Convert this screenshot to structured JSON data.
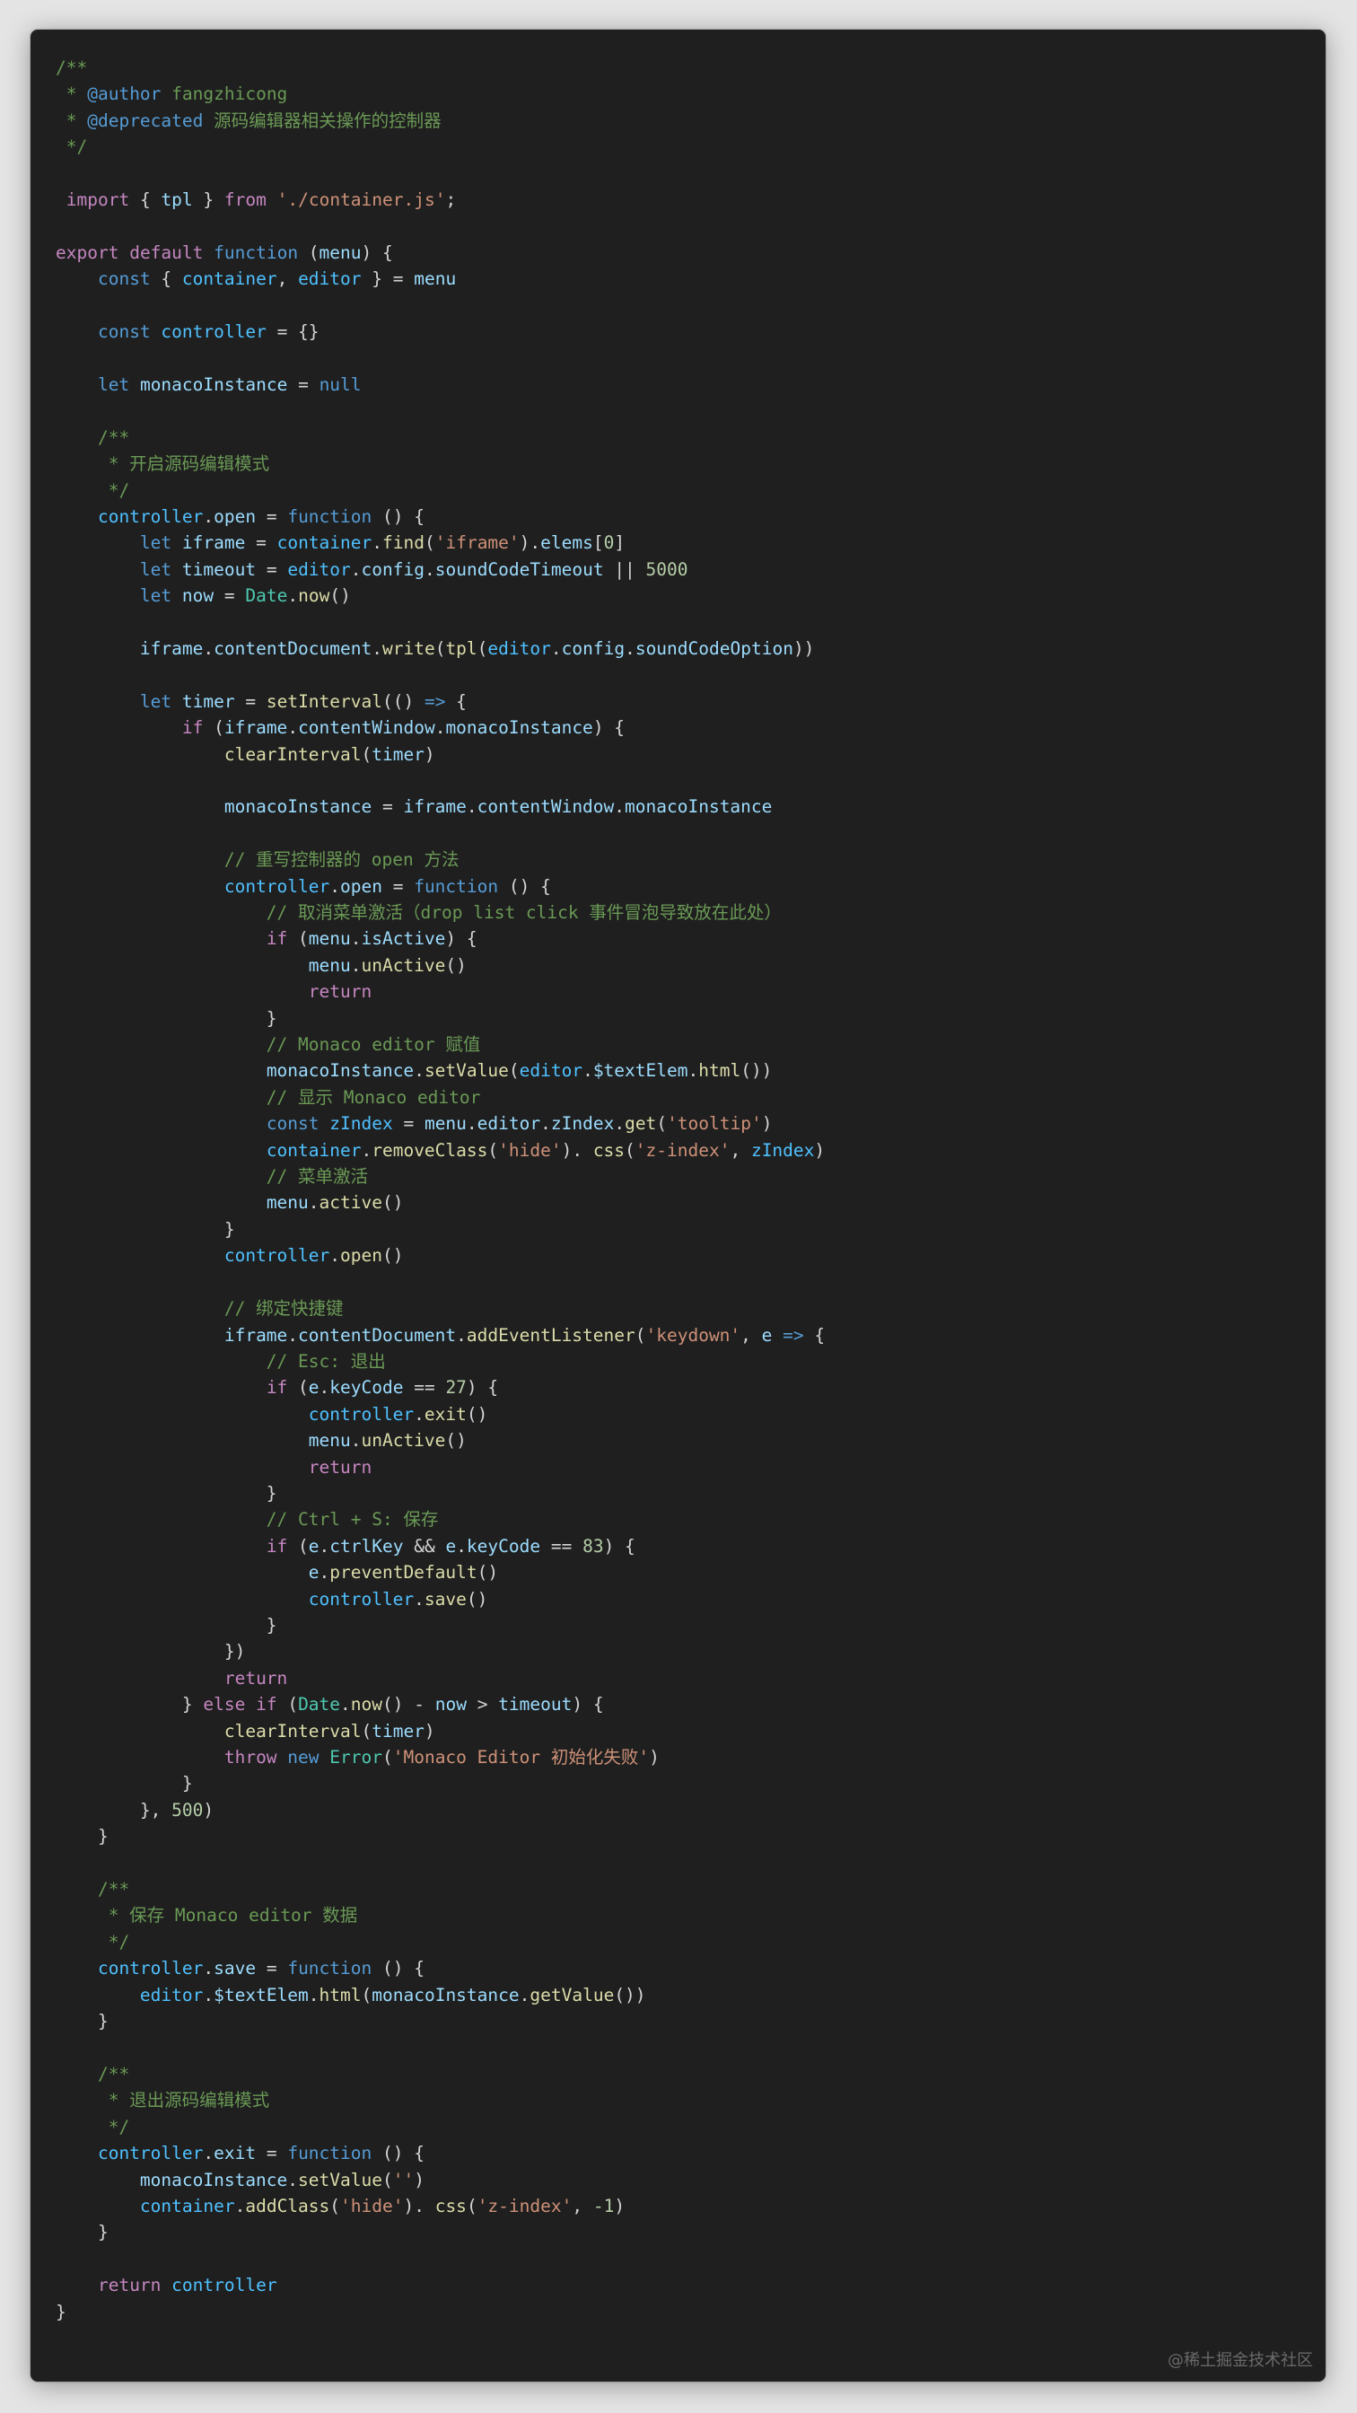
{
  "language": "javascript",
  "watermark": "@稀土掘金技术社区",
  "colors": {
    "background": "#1f1f1f",
    "comment": "#6a9955",
    "keyword_control": "#c586c0",
    "keyword_storage": "#569cd6",
    "variable": "#9cdcfe",
    "constant": "#4fc1ff",
    "function": "#dcdcaa",
    "string": "#ce9178",
    "number": "#b5cea8",
    "class": "#4ec9b0",
    "text": "#d4d4d4"
  },
  "lines": [
    [
      [
        "c",
        "/**"
      ]
    ],
    [
      [
        "c",
        " * "
      ],
      [
        "g",
        "@author"
      ],
      [
        "c",
        " fangzhicong"
      ]
    ],
    [
      [
        "c",
        " * "
      ],
      [
        "g",
        "@deprecated"
      ],
      [
        "c",
        " 源码编辑器相关操作的控制器"
      ]
    ],
    [
      [
        "c",
        " */"
      ]
    ],
    [],
    [
      [
        "p",
        " "
      ],
      [
        "k",
        "import"
      ],
      [
        "p",
        " { "
      ],
      [
        "v",
        "tpl"
      ],
      [
        "p",
        " } "
      ],
      [
        "k",
        "from"
      ],
      [
        "p",
        " "
      ],
      [
        "s",
        "'./container.js'"
      ],
      [
        "p",
        ";"
      ]
    ],
    [],
    [
      [
        "k",
        "export"
      ],
      [
        "p",
        " "
      ],
      [
        "k",
        "default"
      ],
      [
        "p",
        " "
      ],
      [
        "t",
        "function"
      ],
      [
        "p",
        " ("
      ],
      [
        "v",
        "menu"
      ],
      [
        "p",
        ") {"
      ]
    ],
    [
      [
        "p",
        "    "
      ],
      [
        "t",
        "const"
      ],
      [
        "p",
        " { "
      ],
      [
        "o",
        "container"
      ],
      [
        "p",
        ", "
      ],
      [
        "o",
        "editor"
      ],
      [
        "p",
        " } = "
      ],
      [
        "v",
        "menu"
      ]
    ],
    [],
    [
      [
        "p",
        "    "
      ],
      [
        "t",
        "const"
      ],
      [
        "p",
        " "
      ],
      [
        "o",
        "controller"
      ],
      [
        "p",
        " = {}"
      ]
    ],
    [],
    [
      [
        "p",
        "    "
      ],
      [
        "t",
        "let"
      ],
      [
        "p",
        " "
      ],
      [
        "v",
        "monacoInstance"
      ],
      [
        "p",
        " = "
      ],
      [
        "t",
        "null"
      ]
    ],
    [],
    [
      [
        "c",
        "    /**"
      ]
    ],
    [
      [
        "c",
        "     * 开启源码编辑模式"
      ]
    ],
    [
      [
        "c",
        "     */"
      ]
    ],
    [
      [
        "p",
        "    "
      ],
      [
        "o",
        "controller"
      ],
      [
        "p",
        "."
      ],
      [
        "v",
        "open"
      ],
      [
        "p",
        " = "
      ],
      [
        "t",
        "function"
      ],
      [
        "p",
        " () {"
      ]
    ],
    [
      [
        "p",
        "        "
      ],
      [
        "t",
        "let"
      ],
      [
        "p",
        " "
      ],
      [
        "v",
        "iframe"
      ],
      [
        "p",
        " = "
      ],
      [
        "o",
        "container"
      ],
      [
        "p",
        "."
      ],
      [
        "f",
        "find"
      ],
      [
        "p",
        "("
      ],
      [
        "s",
        "'iframe'"
      ],
      [
        "p",
        ")."
      ],
      [
        "v",
        "elems"
      ],
      [
        "p",
        "["
      ],
      [
        "n",
        "0"
      ],
      [
        "p",
        "]"
      ]
    ],
    [
      [
        "p",
        "        "
      ],
      [
        "t",
        "let"
      ],
      [
        "p",
        " "
      ],
      [
        "v",
        "timeout"
      ],
      [
        "p",
        " = "
      ],
      [
        "o",
        "editor"
      ],
      [
        "p",
        "."
      ],
      [
        "v",
        "config"
      ],
      [
        "p",
        "."
      ],
      [
        "v",
        "soundCodeTimeout"
      ],
      [
        "p",
        " || "
      ],
      [
        "n",
        "5000"
      ]
    ],
    [
      [
        "p",
        "        "
      ],
      [
        "t",
        "let"
      ],
      [
        "p",
        " "
      ],
      [
        "v",
        "now"
      ],
      [
        "p",
        " = "
      ],
      [
        "y",
        "Date"
      ],
      [
        "p",
        "."
      ],
      [
        "f",
        "now"
      ],
      [
        "p",
        "()"
      ]
    ],
    [],
    [
      [
        "p",
        "        "
      ],
      [
        "v",
        "iframe"
      ],
      [
        "p",
        "."
      ],
      [
        "v",
        "contentDocument"
      ],
      [
        "p",
        "."
      ],
      [
        "f",
        "write"
      ],
      [
        "p",
        "("
      ],
      [
        "f",
        "tpl"
      ],
      [
        "p",
        "("
      ],
      [
        "o",
        "editor"
      ],
      [
        "p",
        "."
      ],
      [
        "v",
        "config"
      ],
      [
        "p",
        "."
      ],
      [
        "v",
        "soundCodeOption"
      ],
      [
        "p",
        "))"
      ]
    ],
    [],
    [
      [
        "p",
        "        "
      ],
      [
        "t",
        "let"
      ],
      [
        "p",
        " "
      ],
      [
        "v",
        "timer"
      ],
      [
        "p",
        " = "
      ],
      [
        "f",
        "setInterval"
      ],
      [
        "p",
        "(() "
      ],
      [
        "t",
        "=>"
      ],
      [
        "p",
        " {"
      ]
    ],
    [
      [
        "p",
        "            "
      ],
      [
        "k",
        "if"
      ],
      [
        "p",
        " ("
      ],
      [
        "v",
        "iframe"
      ],
      [
        "p",
        "."
      ],
      [
        "v",
        "contentWindow"
      ],
      [
        "p",
        "."
      ],
      [
        "v",
        "monacoInstance"
      ],
      [
        "p",
        ") {"
      ]
    ],
    [
      [
        "p",
        "                "
      ],
      [
        "f",
        "clearInterval"
      ],
      [
        "p",
        "("
      ],
      [
        "v",
        "timer"
      ],
      [
        "p",
        ")"
      ]
    ],
    [],
    [
      [
        "p",
        "                "
      ],
      [
        "v",
        "monacoInstance"
      ],
      [
        "p",
        " = "
      ],
      [
        "v",
        "iframe"
      ],
      [
        "p",
        "."
      ],
      [
        "v",
        "contentWindow"
      ],
      [
        "p",
        "."
      ],
      [
        "v",
        "monacoInstance"
      ]
    ],
    [],
    [
      [
        "c",
        "                // 重写控制器的 open 方法"
      ]
    ],
    [
      [
        "p",
        "                "
      ],
      [
        "o",
        "controller"
      ],
      [
        "p",
        "."
      ],
      [
        "v",
        "open"
      ],
      [
        "p",
        " = "
      ],
      [
        "t",
        "function"
      ],
      [
        "p",
        " () {"
      ]
    ],
    [
      [
        "c",
        "                    // 取消菜单激活（drop list click 事件冒泡导致放在此处）"
      ]
    ],
    [
      [
        "p",
        "                    "
      ],
      [
        "k",
        "if"
      ],
      [
        "p",
        " ("
      ],
      [
        "v",
        "menu"
      ],
      [
        "p",
        "."
      ],
      [
        "v",
        "isActive"
      ],
      [
        "p",
        ") {"
      ]
    ],
    [
      [
        "p",
        "                        "
      ],
      [
        "v",
        "menu"
      ],
      [
        "p",
        "."
      ],
      [
        "f",
        "unActive"
      ],
      [
        "p",
        "()"
      ]
    ],
    [
      [
        "p",
        "                        "
      ],
      [
        "k",
        "return"
      ]
    ],
    [
      [
        "p",
        "                    }"
      ]
    ],
    [
      [
        "c",
        "                    // Monaco editor 赋值"
      ]
    ],
    [
      [
        "p",
        "                    "
      ],
      [
        "v",
        "monacoInstance"
      ],
      [
        "p",
        "."
      ],
      [
        "f",
        "setValue"
      ],
      [
        "p",
        "("
      ],
      [
        "o",
        "editor"
      ],
      [
        "p",
        "."
      ],
      [
        "v",
        "$textElem"
      ],
      [
        "p",
        "."
      ],
      [
        "f",
        "html"
      ],
      [
        "p",
        "())"
      ]
    ],
    [
      [
        "c",
        "                    // 显示 Monaco editor"
      ]
    ],
    [
      [
        "p",
        "                    "
      ],
      [
        "t",
        "const"
      ],
      [
        "p",
        " "
      ],
      [
        "o",
        "zIndex"
      ],
      [
        "p",
        " = "
      ],
      [
        "v",
        "menu"
      ],
      [
        "p",
        "."
      ],
      [
        "v",
        "editor"
      ],
      [
        "p",
        "."
      ],
      [
        "v",
        "zIndex"
      ],
      [
        "p",
        "."
      ],
      [
        "f",
        "get"
      ],
      [
        "p",
        "("
      ],
      [
        "s",
        "'tooltip'"
      ],
      [
        "p",
        ")"
      ]
    ],
    [
      [
        "p",
        "                    "
      ],
      [
        "o",
        "container"
      ],
      [
        "p",
        "."
      ],
      [
        "f",
        "removeClass"
      ],
      [
        "p",
        "("
      ],
      [
        "s",
        "'hide'"
      ],
      [
        "p",
        "). "
      ],
      [
        "f",
        "css"
      ],
      [
        "p",
        "("
      ],
      [
        "s",
        "'z-index'"
      ],
      [
        "p",
        ", "
      ],
      [
        "o",
        "zIndex"
      ],
      [
        "p",
        ")"
      ]
    ],
    [
      [
        "c",
        "                    // 菜单激活"
      ]
    ],
    [
      [
        "p",
        "                    "
      ],
      [
        "v",
        "menu"
      ],
      [
        "p",
        "."
      ],
      [
        "f",
        "active"
      ],
      [
        "p",
        "()"
      ]
    ],
    [
      [
        "p",
        "                }"
      ]
    ],
    [
      [
        "p",
        "                "
      ],
      [
        "o",
        "controller"
      ],
      [
        "p",
        "."
      ],
      [
        "f",
        "open"
      ],
      [
        "p",
        "()"
      ]
    ],
    [],
    [
      [
        "c",
        "                // 绑定快捷键"
      ]
    ],
    [
      [
        "p",
        "                "
      ],
      [
        "v",
        "iframe"
      ],
      [
        "p",
        "."
      ],
      [
        "v",
        "contentDocument"
      ],
      [
        "p",
        "."
      ],
      [
        "f",
        "addEventListener"
      ],
      [
        "p",
        "("
      ],
      [
        "s",
        "'keydown'"
      ],
      [
        "p",
        ", "
      ],
      [
        "v",
        "e"
      ],
      [
        "p",
        " "
      ],
      [
        "t",
        "=>"
      ],
      [
        "p",
        " {"
      ]
    ],
    [
      [
        "c",
        "                    // Esc: 退出"
      ]
    ],
    [
      [
        "p",
        "                    "
      ],
      [
        "k",
        "if"
      ],
      [
        "p",
        " ("
      ],
      [
        "v",
        "e"
      ],
      [
        "p",
        "."
      ],
      [
        "v",
        "keyCode"
      ],
      [
        "p",
        " == "
      ],
      [
        "n",
        "27"
      ],
      [
        "p",
        ") {"
      ]
    ],
    [
      [
        "p",
        "                        "
      ],
      [
        "o",
        "controller"
      ],
      [
        "p",
        "."
      ],
      [
        "f",
        "exit"
      ],
      [
        "p",
        "()"
      ]
    ],
    [
      [
        "p",
        "                        "
      ],
      [
        "v",
        "menu"
      ],
      [
        "p",
        "."
      ],
      [
        "f",
        "unActive"
      ],
      [
        "p",
        "()"
      ]
    ],
    [
      [
        "p",
        "                        "
      ],
      [
        "k",
        "return"
      ]
    ],
    [
      [
        "p",
        "                    }"
      ]
    ],
    [
      [
        "c",
        "                    // Ctrl + S: 保存"
      ]
    ],
    [
      [
        "p",
        "                    "
      ],
      [
        "k",
        "if"
      ],
      [
        "p",
        " ("
      ],
      [
        "v",
        "e"
      ],
      [
        "p",
        "."
      ],
      [
        "v",
        "ctrlKey"
      ],
      [
        "p",
        " && "
      ],
      [
        "v",
        "e"
      ],
      [
        "p",
        "."
      ],
      [
        "v",
        "keyCode"
      ],
      [
        "p",
        " == "
      ],
      [
        "n",
        "83"
      ],
      [
        "p",
        ") {"
      ]
    ],
    [
      [
        "p",
        "                        "
      ],
      [
        "v",
        "e"
      ],
      [
        "p",
        "."
      ],
      [
        "f",
        "preventDefault"
      ],
      [
        "p",
        "()"
      ]
    ],
    [
      [
        "p",
        "                        "
      ],
      [
        "o",
        "controller"
      ],
      [
        "p",
        "."
      ],
      [
        "f",
        "save"
      ],
      [
        "p",
        "()"
      ]
    ],
    [
      [
        "p",
        "                    }"
      ]
    ],
    [
      [
        "p",
        "                })"
      ]
    ],
    [
      [
        "p",
        "                "
      ],
      [
        "k",
        "return"
      ]
    ],
    [
      [
        "p",
        "            } "
      ],
      [
        "k",
        "else"
      ],
      [
        "p",
        " "
      ],
      [
        "k",
        "if"
      ],
      [
        "p",
        " ("
      ],
      [
        "y",
        "Date"
      ],
      [
        "p",
        "."
      ],
      [
        "f",
        "now"
      ],
      [
        "p",
        "() - "
      ],
      [
        "v",
        "now"
      ],
      [
        "p",
        " > "
      ],
      [
        "v",
        "timeout"
      ],
      [
        "p",
        ") {"
      ]
    ],
    [
      [
        "p",
        "                "
      ],
      [
        "f",
        "clearInterval"
      ],
      [
        "p",
        "("
      ],
      [
        "v",
        "timer"
      ],
      [
        "p",
        ")"
      ]
    ],
    [
      [
        "p",
        "                "
      ],
      [
        "k",
        "throw"
      ],
      [
        "p",
        " "
      ],
      [
        "t",
        "new"
      ],
      [
        "p",
        " "
      ],
      [
        "y",
        "Error"
      ],
      [
        "p",
        "("
      ],
      [
        "s",
        "'Monaco Editor 初始化失败'"
      ],
      [
        "p",
        ")"
      ]
    ],
    [
      [
        "p",
        "            }"
      ]
    ],
    [
      [
        "p",
        "        }, "
      ],
      [
        "n",
        "500"
      ],
      [
        "p",
        ")"
      ]
    ],
    [
      [
        "p",
        "    }"
      ]
    ],
    [],
    [
      [
        "c",
        "    /**"
      ]
    ],
    [
      [
        "c",
        "     * 保存 Monaco editor 数据"
      ]
    ],
    [
      [
        "c",
        "     */"
      ]
    ],
    [
      [
        "p",
        "    "
      ],
      [
        "o",
        "controller"
      ],
      [
        "p",
        "."
      ],
      [
        "v",
        "save"
      ],
      [
        "p",
        " = "
      ],
      [
        "t",
        "function"
      ],
      [
        "p",
        " () {"
      ]
    ],
    [
      [
        "p",
        "        "
      ],
      [
        "o",
        "editor"
      ],
      [
        "p",
        "."
      ],
      [
        "v",
        "$textElem"
      ],
      [
        "p",
        "."
      ],
      [
        "f",
        "html"
      ],
      [
        "p",
        "("
      ],
      [
        "v",
        "monacoInstance"
      ],
      [
        "p",
        "."
      ],
      [
        "f",
        "getValue"
      ],
      [
        "p",
        "())"
      ]
    ],
    [
      [
        "p",
        "    }"
      ]
    ],
    [],
    [
      [
        "c",
        "    /**"
      ]
    ],
    [
      [
        "c",
        "     * 退出源码编辑模式"
      ]
    ],
    [
      [
        "c",
        "     */"
      ]
    ],
    [
      [
        "p",
        "    "
      ],
      [
        "o",
        "controller"
      ],
      [
        "p",
        "."
      ],
      [
        "v",
        "exit"
      ],
      [
        "p",
        " = "
      ],
      [
        "t",
        "function"
      ],
      [
        "p",
        " () {"
      ]
    ],
    [
      [
        "p",
        "        "
      ],
      [
        "v",
        "monacoInstance"
      ],
      [
        "p",
        "."
      ],
      [
        "f",
        "setValue"
      ],
      [
        "p",
        "("
      ],
      [
        "s",
        "''"
      ],
      [
        "p",
        ")"
      ]
    ],
    [
      [
        "p",
        "        "
      ],
      [
        "o",
        "container"
      ],
      [
        "p",
        "."
      ],
      [
        "f",
        "addClass"
      ],
      [
        "p",
        "("
      ],
      [
        "s",
        "'hide'"
      ],
      [
        "p",
        "). "
      ],
      [
        "f",
        "css"
      ],
      [
        "p",
        "("
      ],
      [
        "s",
        "'z-index'"
      ],
      [
        "p",
        ", "
      ],
      [
        "n",
        "-1"
      ],
      [
        "p",
        ")"
      ]
    ],
    [
      [
        "p",
        "    }"
      ]
    ],
    [],
    [
      [
        "p",
        "    "
      ],
      [
        "k",
        "return"
      ],
      [
        "p",
        " "
      ],
      [
        "o",
        "controller"
      ]
    ],
    [
      [
        "p",
        "}"
      ]
    ]
  ]
}
